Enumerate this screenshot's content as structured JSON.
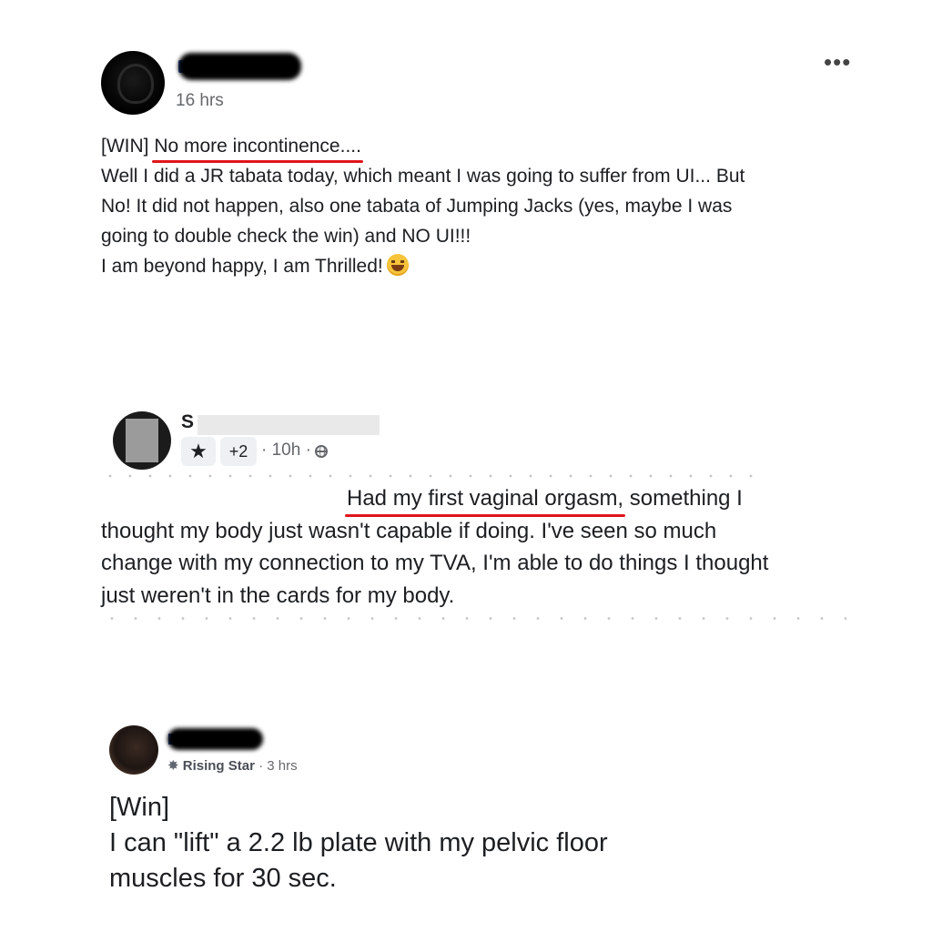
{
  "posts": [
    {
      "timestamp": "16 hrs",
      "more_menu": "•••",
      "body": {
        "line1_prefix": "[WIN] ",
        "line1_highlight": "No more incontinence....",
        "line2": "Well I did a JR tabata today, which meant I was going to suffer from UI... But",
        "line3": "No! It did not happen, also one tabata of Jumping Jacks (yes, maybe I was",
        "line4": "going to double check the win) and NO UI!!!",
        "line5": "I am beyond happy, I am Thrilled!"
      },
      "emoji": "grinning-squinting-face"
    },
    {
      "name_initial": "S",
      "badge_count": "+2",
      "meta": "· 10h ·",
      "privacy_icon": "globe-icon",
      "body": {
        "line1_highlight": "Had my first vaginal orgasm,",
        "line1_rest": " something I",
        "line2": "thought my body just wasn't capable if doing. I've seen so much",
        "line3": "change with my connection to my TVA, I'm able to do things I thought",
        "line4": "just weren't in the cards for my body."
      }
    },
    {
      "rank": "Rising Star",
      "meta": "· 3 hrs",
      "body": {
        "line1": "[Win]",
        "line2": "I can \"lift\" a 2.2 lb plate with my pelvic floor",
        "line3": "muscles for 30 sec."
      }
    }
  ],
  "colors": {
    "underline": "#e0151b",
    "meta_text": "#65676b",
    "body_text": "#1c1e21"
  }
}
